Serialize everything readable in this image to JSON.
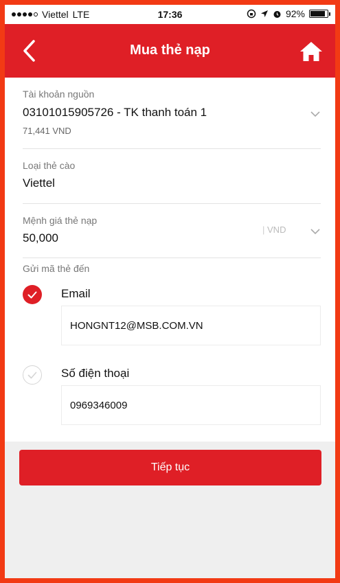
{
  "status_bar": {
    "carrier": "Viettel",
    "network": "LTE",
    "time": "17:36",
    "battery": "92%",
    "battery_level": 0.92
  },
  "header": {
    "title": "Mua thẻ nạp",
    "back_icon": "chevron-left-icon",
    "home_icon": "home-icon"
  },
  "source_account": {
    "label": "Tài khoản nguồn",
    "account": "03101015905726 - TK thanh toán 1",
    "balance": "71,441 VND"
  },
  "card_type": {
    "label": "Loại thẻ cào",
    "value": "Viettel"
  },
  "denomination": {
    "label": "Mệnh giá thẻ nạp",
    "value": "50,000",
    "currency": "VND"
  },
  "send_to": {
    "label": "Gửi mã thẻ đến",
    "email": {
      "label": "Email",
      "value": "HONGNT12@MSB.COM.VN",
      "checked": true
    },
    "phone": {
      "label": "Số điện thoại",
      "value": "0969346009",
      "checked": false
    }
  },
  "continue_label": "Tiếp tục",
  "colors": {
    "accent": "#df1f26",
    "frame": "#f23a14"
  }
}
